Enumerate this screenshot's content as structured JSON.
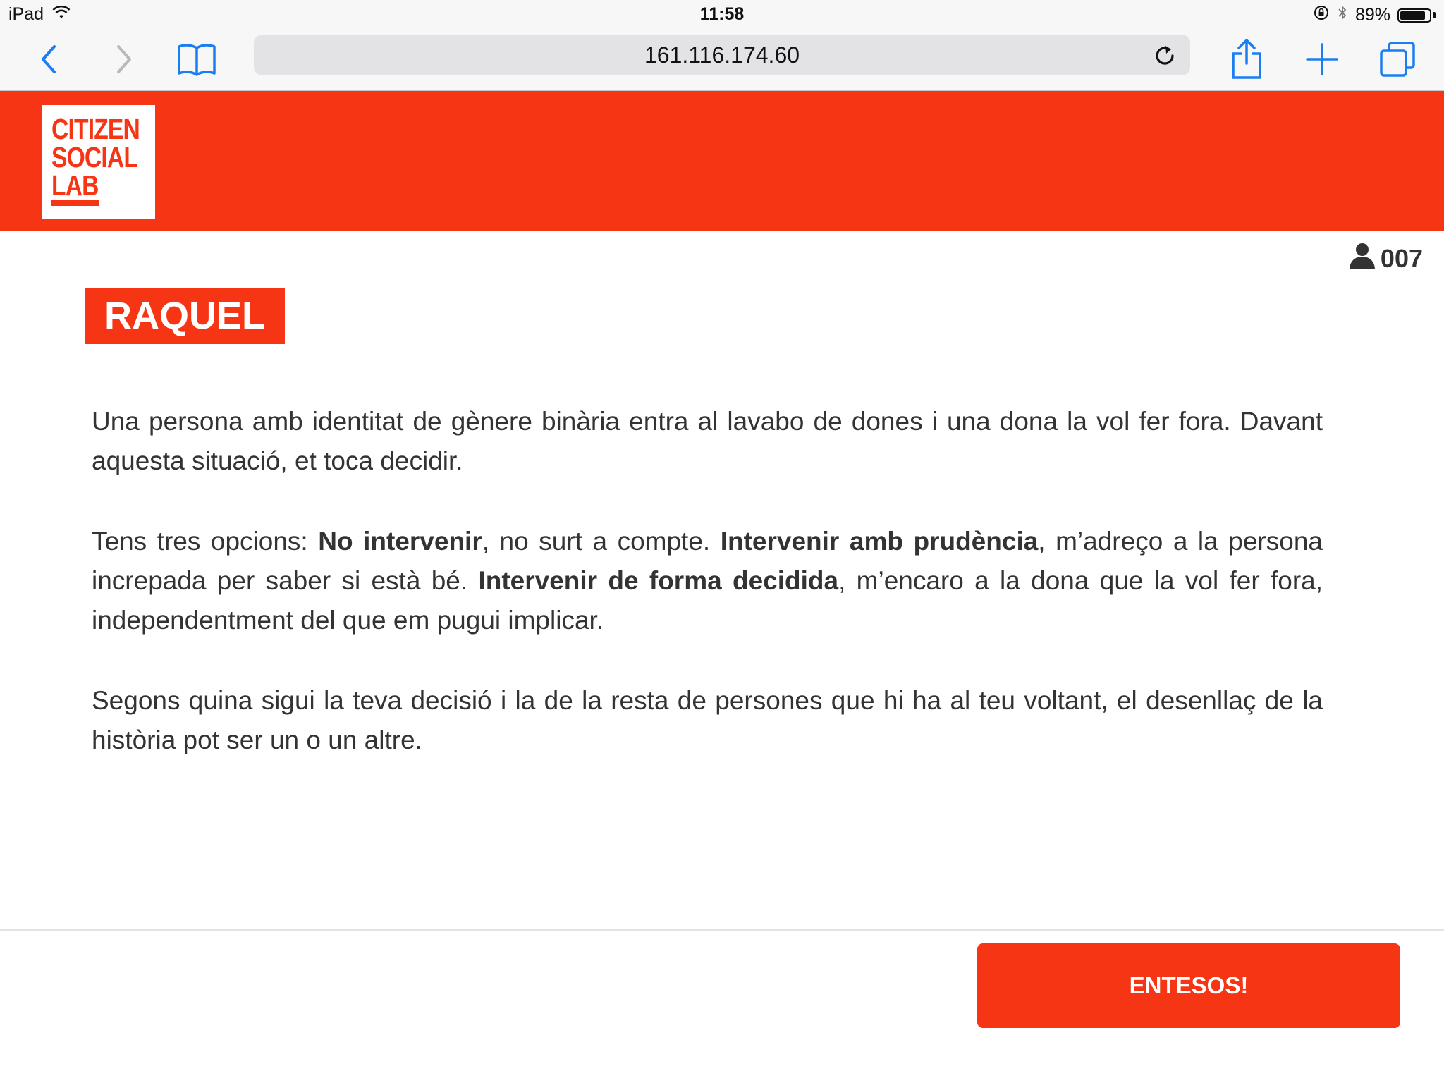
{
  "status_bar": {
    "device": "iPad",
    "time": "11:58",
    "battery": "89%",
    "battery_level": 0.89
  },
  "browser": {
    "url": "161.116.174.60",
    "icons": [
      "back-icon",
      "forward-icon",
      "bookmarks-icon",
      "reload-icon",
      "share-icon",
      "new-tab-icon",
      "tabs-icon"
    ]
  },
  "header": {
    "logo_lines": [
      "CITIZEN",
      "SOCIAL",
      "LAB"
    ],
    "brand_color": "#f53514"
  },
  "user": {
    "code": "007",
    "icon": "user-icon"
  },
  "character": {
    "name": "RAQUEL"
  },
  "story": {
    "p1": "Una persona amb identitat de gènere binària entra al lavabo de dones i una dona la vol fer fora. Davant aquesta situació, et toca decidir.",
    "p2_intro": "Tens tres opcions: ",
    "option1": "No intervenir",
    "option1_desc": ", no surt a compte. ",
    "option2": "Intervenir amb prudència",
    "option2_desc": ", m’adreço a la persona increpada per saber si està bé. ",
    "option3": "Intervenir de forma decidida",
    "option3_desc": ", m’encaro a la dona que la vol fer fora, independentment del que em pugui implicar.",
    "p3": "Segons quina sigui la teva decisió i la de la resta de persones que hi ha al teu voltant, el desenllaç de la història pot ser un o un altre."
  },
  "actions": {
    "confirm_label": "ENTESOS!"
  }
}
